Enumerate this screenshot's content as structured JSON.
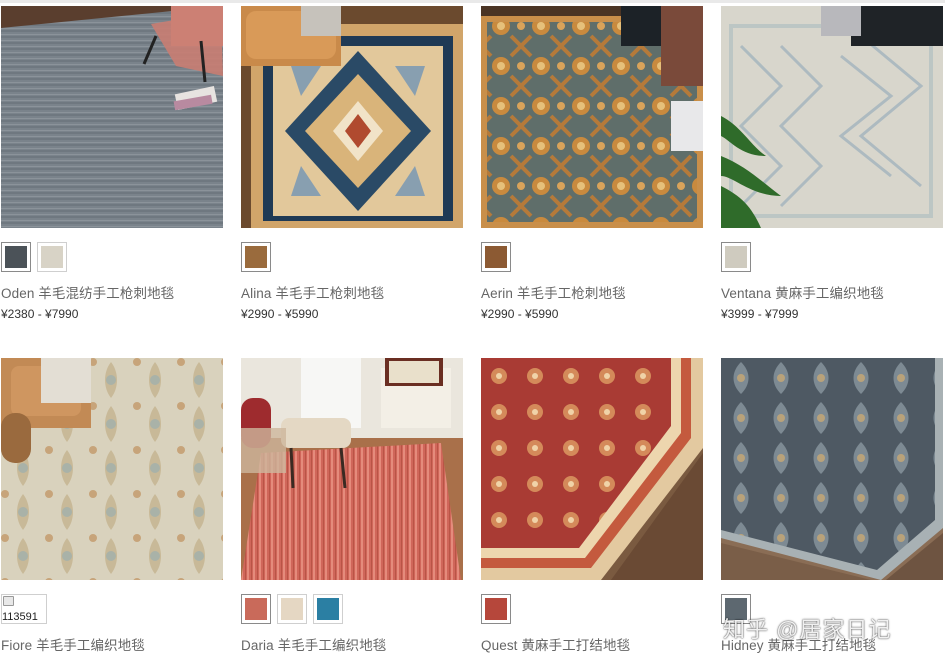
{
  "watermark": "知乎 @居家日记",
  "products": [
    {
      "name": "Oden 羊毛混纺手工枪刺地毯",
      "price": "¥2380 - ¥7990",
      "image": "oden-rug",
      "swatches": [
        "#4b5258",
        "#d8d3c6"
      ]
    },
    {
      "name": "Alina 羊毛手工枪刺地毯",
      "price": "¥2990 - ¥5990",
      "image": "alina-rug",
      "swatches": [
        "#9a6b3d"
      ]
    },
    {
      "name": "Aerin 羊毛手工枪刺地毯",
      "price": "¥2990 - ¥5990",
      "image": "aerin-rug",
      "swatches": [
        "#8c5a33"
      ]
    },
    {
      "name": "Ventana 黄麻手工编织地毯",
      "price": "¥3999 - ¥7999",
      "image": "ventana-rug",
      "swatches": [
        "#cfcbbf"
      ]
    },
    {
      "name": "Fiore 羊毛手工编织地毯",
      "price": "",
      "image": "fiore-rug",
      "broken_swatch_text": "113591",
      "swatches": []
    },
    {
      "name": "Daria 羊毛手工编织地毯",
      "price": "",
      "image": "daria-rug",
      "swatches": [
        "#c96a5a",
        "#e5d7c3",
        "#2b7fa3"
      ]
    },
    {
      "name": "Quest 黄麻手工打结地毯",
      "price": "",
      "image": "quest-rug",
      "swatches": [
        "#b6473b"
      ]
    },
    {
      "name": "Hidney 黄麻手工打结地毯",
      "price": "",
      "image": "hidney-rug",
      "swatches": [
        "#5d6870"
      ]
    }
  ]
}
